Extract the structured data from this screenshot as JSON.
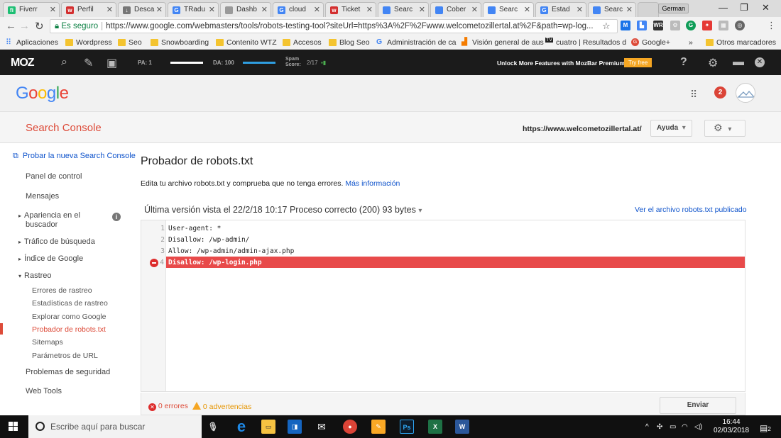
{
  "browser": {
    "tabs": [
      {
        "label": "Fiverr",
        "icon": "fiverr-icon",
        "color": "#1dbf73",
        "glyph": "fi"
      },
      {
        "label": "Perfil",
        "icon": "fiverr-icon",
        "color": "#d32f2f",
        "glyph": "w"
      },
      {
        "label": "Desca",
        "icon": "download-icon",
        "color": "#777777",
        "glyph": "↓"
      },
      {
        "label": "TRadu",
        "icon": "google-icon",
        "color": "#4285f4",
        "glyph": "G"
      },
      {
        "label": "Dashb",
        "icon": "page-icon",
        "color": "#999999",
        "glyph": ""
      },
      {
        "label": "cloud",
        "icon": "google-icon",
        "color": "#4285f4",
        "glyph": "G"
      },
      {
        "label": "Ticket",
        "icon": "fiverr-icon",
        "color": "#d32f2f",
        "glyph": "w"
      },
      {
        "label": "Searc",
        "icon": "search-console-icon",
        "color": "#4285f4",
        "glyph": ""
      },
      {
        "label": "Cober",
        "icon": "search-console-icon",
        "color": "#4285f4",
        "glyph": ""
      },
      {
        "label": "Searc",
        "icon": "search-console-icon",
        "color": "#4285f4",
        "glyph": ""
      },
      {
        "label": "Estad",
        "icon": "google-icon",
        "color": "#4285f4",
        "glyph": "G"
      },
      {
        "label": "Searc",
        "icon": "search-console-icon",
        "color": "#4285f4",
        "glyph": ""
      }
    ],
    "user_label": "German",
    "secure_label": "Es seguro",
    "url": "https://www.google.com/webmasters/tools/robots-testing-tool?siteUrl=https%3A%2F%2Fwww.welcometozillertal.at%2F&path=wp-log...",
    "bookmarks": {
      "apps": "Aplicaciones",
      "items": [
        "Wordpress",
        "Seo",
        "Snowboarding",
        "Contenito WTZ",
        "Accesos",
        "Blog Seo"
      ],
      "admin": "Administración de ca",
      "vision": "Visión general de aus",
      "cuatro": "cuatro | Resultados d",
      "gplus": "Google+",
      "more": "»",
      "others": "Otros marcadores"
    }
  },
  "mozbar": {
    "logo": "MOZ",
    "pa_label": "PA: 1",
    "da_label": "DA: 100",
    "spam_label": "Spam Score:",
    "spam_value": "2/17",
    "premium_text": "Unlock More Features with MozBar Premium",
    "try_free": "Try free",
    "help_icon": "?"
  },
  "google": {
    "logo": "Google",
    "notifications": "2"
  },
  "console": {
    "title": "Search Console",
    "site": "https://www.welcometozillertal.at/",
    "help_label": "Ayuda",
    "help_caret": "▾",
    "gear_caret": "▾"
  },
  "sidebar": {
    "try_new": "Probar la nueva Search Console",
    "control_panel": "Panel de control",
    "messages": "Mensajes",
    "appearance_line1": "Apariencia en el",
    "appearance_line2": "buscador",
    "traffic": "Tráfico de búsqueda",
    "index": "Índice de Google",
    "crawl": "Rastreo",
    "crawl_errors": "Errores de rastreo",
    "crawl_stats": "Estadísticas de rastreo",
    "fetch_as_google": "Explorar como Google",
    "robots_tester": "Probador de robots.txt",
    "sitemaps": "Sitemaps",
    "url_params": "Parámetros de URL",
    "security": "Problemas de seguridad",
    "web_tools": "Web Tools"
  },
  "main": {
    "title": "Probador de robots.txt",
    "description": "Edita tu archivo robots.txt y comprueba que no tenga errores.",
    "more_info": "Más información",
    "last_version": "Última versión vista el 22/2/18 10:17 Proceso correcto (200) 93 bytes",
    "last_version_caret": "▾",
    "view_published": "Ver el archivo robots.txt publicado",
    "lines": [
      {
        "n": "1",
        "text": "User-agent: *"
      },
      {
        "n": "2",
        "text": "Disallow: /wp-admin/"
      },
      {
        "n": "3",
        "text": "Allow: /wp-admin/admin-ajax.php"
      },
      {
        "n": "4",
        "text": "Disallow: /wp-login.php"
      }
    ],
    "errors": "0 errores",
    "warnings": "0 advertencias",
    "send": "Enviar"
  },
  "taskbar": {
    "search_placeholder": "Escribe aquí para buscar",
    "time": "16:44",
    "date": "02/03/2018",
    "notif_count": "2"
  },
  "colors": {
    "error_red": "#e84a4a",
    "console_red": "#dd4b39",
    "link_blue": "#1155cc",
    "moz_dark": "#1b1b1b"
  }
}
